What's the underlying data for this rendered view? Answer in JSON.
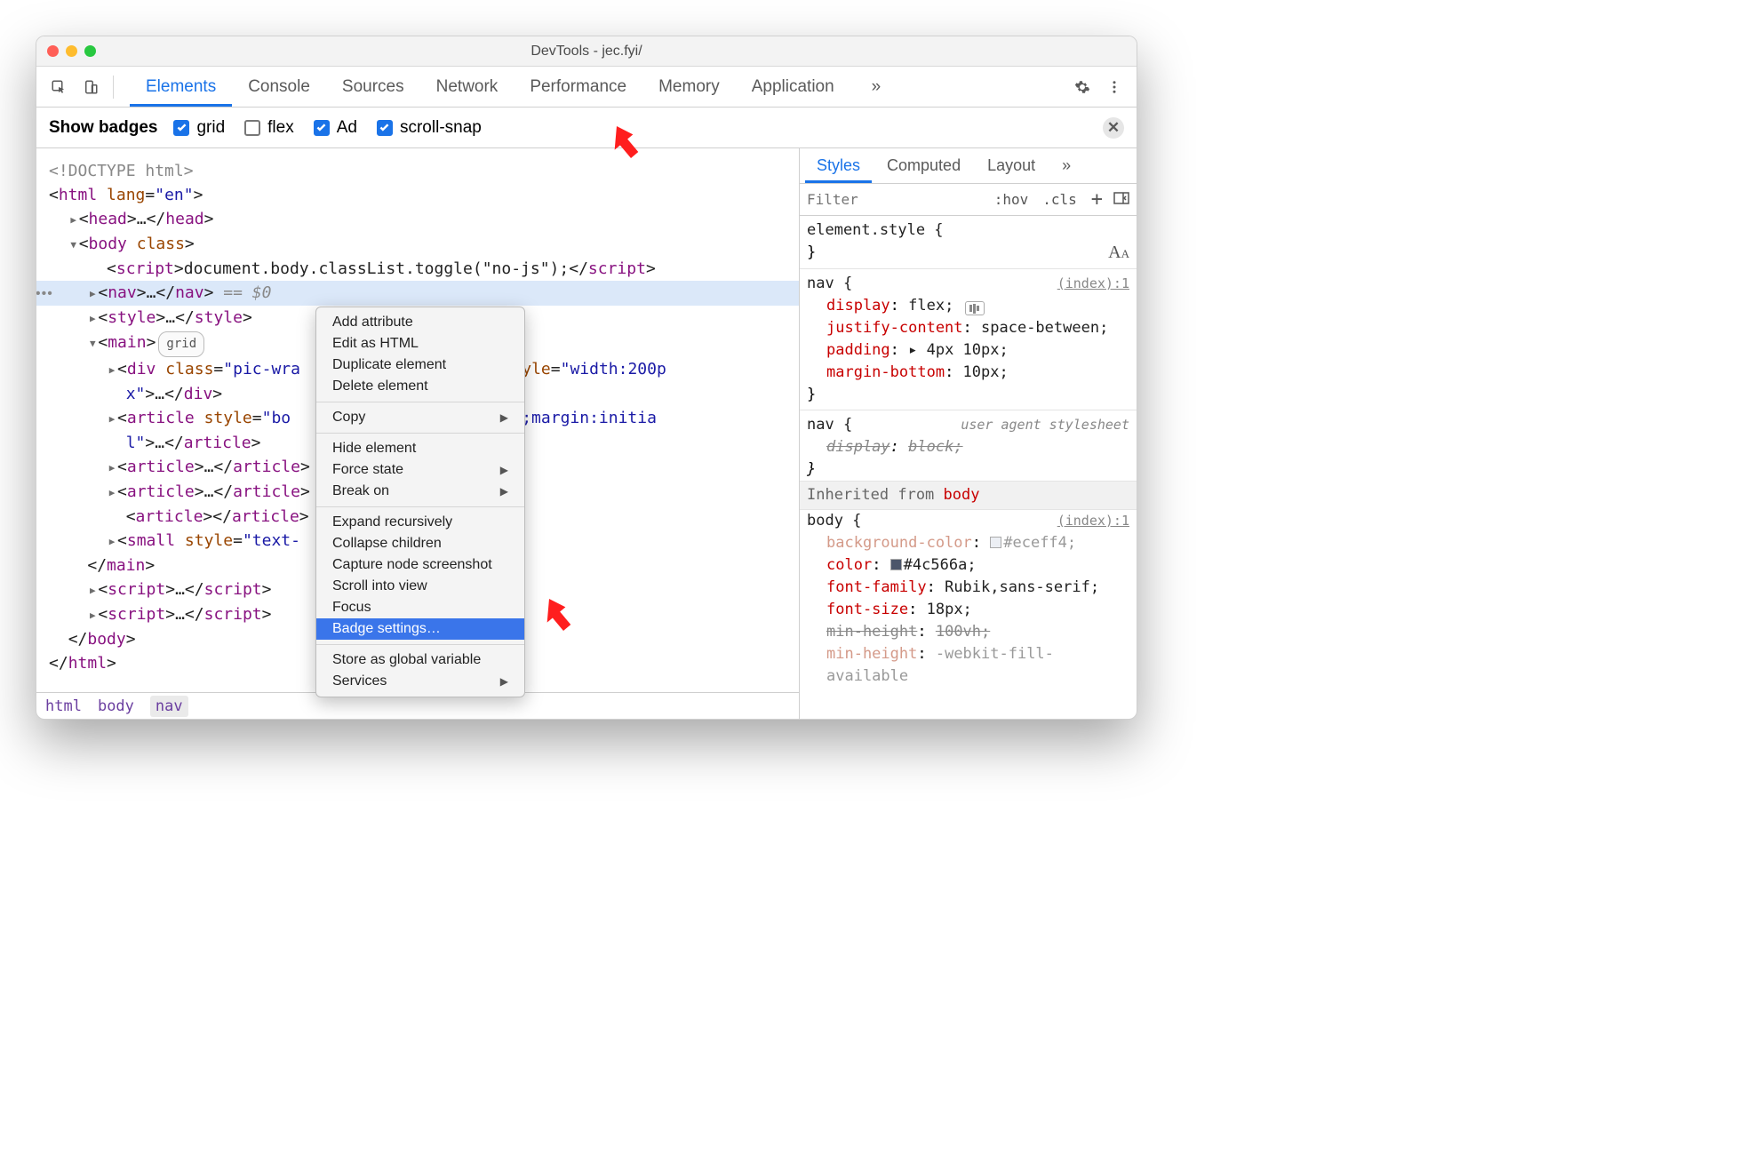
{
  "window": {
    "title": "DevTools - jec.fyi/"
  },
  "mainTabs": [
    "Elements",
    "Console",
    "Sources",
    "Network",
    "Performance",
    "Memory",
    "Application"
  ],
  "activeMainTab": 0,
  "badges": {
    "label": "Show badges",
    "items": [
      {
        "label": "grid",
        "checked": true
      },
      {
        "label": "flex",
        "checked": false
      },
      {
        "label": "Ad",
        "checked": true
      },
      {
        "label": "scroll-snap",
        "checked": true
      }
    ]
  },
  "dom": {
    "doctype": "<!DOCTYPE html>",
    "htmlOpen": {
      "tag": "html",
      "attr": "lang",
      "val": "\"en\""
    },
    "head": {
      "tag": "head"
    },
    "bodyOpen": {
      "tag": "body",
      "attr": "class"
    },
    "script1": {
      "tag": "script",
      "text": "document.body.classList.toggle(\"no-js\");"
    },
    "nav": {
      "tag": "nav",
      "suffix": " == $0"
    },
    "style1": {
      "tag": "style"
    },
    "mainOpen": {
      "tag": "main",
      "badge": "grid"
    },
    "div1": {
      "tag": "div",
      "attrs": "class=\"pic-wra",
      "more": "o\" style=\"width:200p",
      "cont": "x\">…"
    },
    "art1": {
      "tag": "article",
      "attrs": "style=\"bo",
      "more": "nitial;margin:initia",
      "cont": "l\">…"
    },
    "art2": {
      "tag": "article"
    },
    "art3": {
      "tag": "article"
    },
    "art4empty": {
      "tag": "article"
    },
    "small": {
      "tag": "small",
      "attrs": "style=\"text-",
      "more": "l"
    },
    "mainClose": "</main>",
    "scriptA": {
      "tag": "script"
    },
    "scriptB": {
      "tag": "script"
    },
    "bodyClose": "</body>",
    "htmlClose": "</html>"
  },
  "crumbs": [
    "html",
    "body",
    "nav"
  ],
  "activeCrumb": 2,
  "sidebarTabs": [
    "Styles",
    "Computed",
    "Layout"
  ],
  "activeSidebarTab": 0,
  "filter": {
    "placeholder": "Filter",
    "hov": ":hov",
    "cls": ".cls"
  },
  "styles": {
    "elementStyle": "element.style {",
    "navRule": {
      "selector": "nav {",
      "src": "(index):1",
      "props": [
        {
          "p": "display",
          "v": "flex",
          "flexicon": true
        },
        {
          "p": "justify-content",
          "v": "space-between"
        },
        {
          "p": "padding",
          "v": "▸ 4px 10px"
        },
        {
          "p": "margin-bottom",
          "v": "10px"
        }
      ]
    },
    "uaNav": {
      "selector": "nav {",
      "src": "user agent stylesheet",
      "props": [
        {
          "p": "display",
          "v": "block",
          "over": true,
          "italic": true
        }
      ]
    },
    "inheritedFrom": "Inherited from ",
    "inheritedLink": "body",
    "bodyRule": {
      "selector": "body {",
      "src": "(index):1",
      "props": [
        {
          "p": "background-color",
          "v": "#eceff4",
          "swatch": "#eceff4",
          "dim": true
        },
        {
          "p": "color",
          "v": "#4c566a",
          "swatch": "#4c566a"
        },
        {
          "p": "font-family",
          "v": "Rubik,sans-serif"
        },
        {
          "p": "font-size",
          "v": "18px"
        },
        {
          "p": "min-height",
          "v": "100vh",
          "over": true
        },
        {
          "p": "min-height",
          "v": "-webkit-fill-available",
          "partial": true,
          "dim": true
        }
      ]
    }
  },
  "contextMenu": {
    "groups": [
      [
        "Add attribute",
        "Edit as HTML",
        "Duplicate element",
        "Delete element"
      ],
      [
        {
          "t": "Copy",
          "sub": true
        }
      ],
      [
        "Hide element",
        {
          "t": "Force state",
          "sub": true
        },
        {
          "t": "Break on",
          "sub": true
        }
      ],
      [
        "Expand recursively",
        "Collapse children",
        "Capture node screenshot",
        "Scroll into view",
        "Focus",
        {
          "t": "Badge settings…",
          "hl": true
        }
      ],
      [
        "Store as global variable",
        {
          "t": "Services",
          "sub": true
        }
      ]
    ]
  }
}
